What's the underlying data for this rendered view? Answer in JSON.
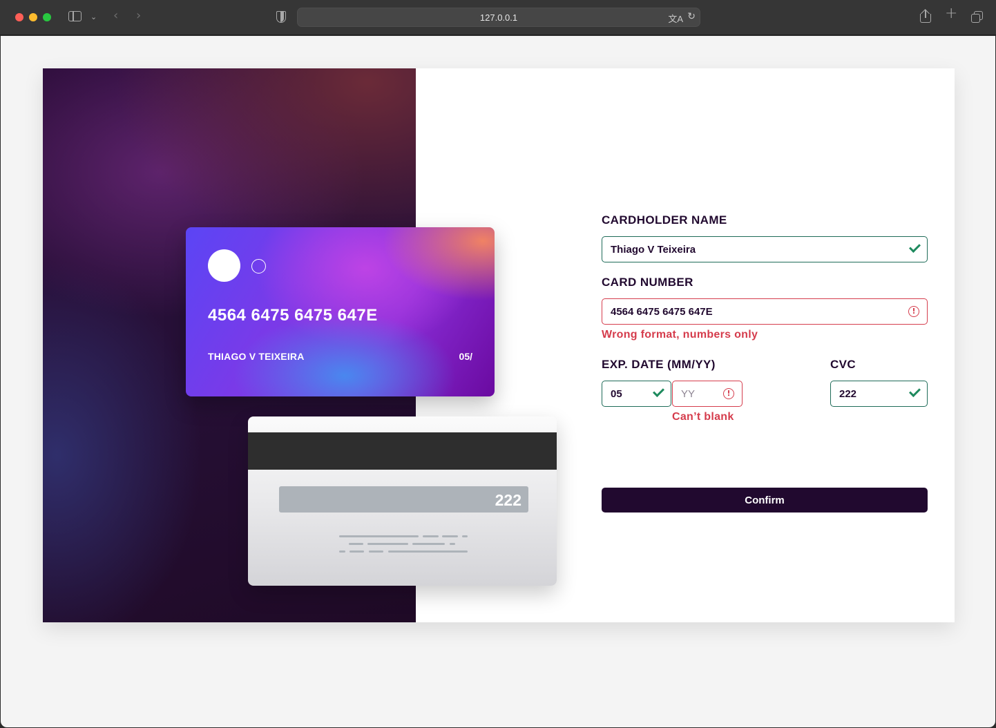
{
  "browser": {
    "url": "127.0.0.1"
  },
  "card_front": {
    "number": "4564 6475 6475 647E",
    "holder": "THIAGO V TEIXEIRA",
    "expiry": "05/"
  },
  "card_back": {
    "cvc": "222"
  },
  "form": {
    "cardholder": {
      "label": "CARDHOLDER NAME",
      "value": "Thiago V Teixeira",
      "status": "valid"
    },
    "card_number": {
      "label": "CARD NUMBER",
      "value": "4564 6475 6475 647E",
      "status": "error",
      "error": "Wrong format, numbers only"
    },
    "exp_date": {
      "label": "EXP. DATE (MM/YY)",
      "month_value": "05",
      "month_status": "valid",
      "year_value": "",
      "year_placeholder": "YY",
      "year_status": "error",
      "error": "Can’t blank"
    },
    "cvc": {
      "label": "CVC",
      "value": "222",
      "status": "valid"
    },
    "confirm_label": "Confirm"
  },
  "colors": {
    "primary_dark": "#21092f",
    "valid": "#1e6b58",
    "error": "#d53c4c"
  }
}
